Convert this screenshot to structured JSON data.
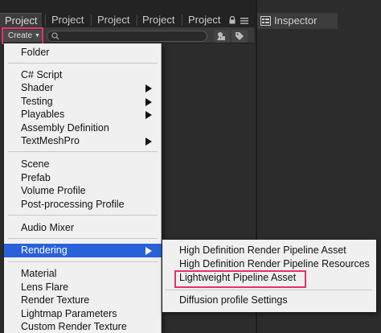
{
  "tabs": [
    {
      "label": "Project"
    },
    {
      "label": "Project"
    },
    {
      "label": "Project"
    },
    {
      "label": "Project"
    },
    {
      "label": "Project"
    }
  ],
  "inspector": {
    "label": "Inspector"
  },
  "toolbar": {
    "create_label": "Create",
    "search_placeholder": ""
  },
  "menu": {
    "items": [
      {
        "label": "Folder"
      },
      {
        "label": "C# Script"
      },
      {
        "label": "Shader"
      },
      {
        "label": "Testing"
      },
      {
        "label": "Playables"
      },
      {
        "label": "Assembly Definition"
      },
      {
        "label": "TextMeshPro"
      },
      {
        "label": "Scene"
      },
      {
        "label": "Prefab"
      },
      {
        "label": "Volume Profile"
      },
      {
        "label": "Post-processing Profile"
      },
      {
        "label": "Audio Mixer"
      },
      {
        "label": "Rendering"
      },
      {
        "label": "Material"
      },
      {
        "label": "Lens Flare"
      },
      {
        "label": "Render Texture"
      },
      {
        "label": "Lightmap Parameters"
      },
      {
        "label": "Custom Render Texture"
      }
    ]
  },
  "submenu": {
    "items": [
      {
        "label": "High Definition Render Pipeline Asset"
      },
      {
        "label": "High Definition Render Pipeline Resources"
      },
      {
        "label": "Lightweight Pipeline Asset"
      },
      {
        "label": "Diffusion profile Settings"
      }
    ]
  },
  "colors": {
    "selection": "#2861d9",
    "highlight_box": "#e0336d",
    "menu_bg": "#f0f0f0",
    "editor_bg": "#2c2c2c"
  }
}
